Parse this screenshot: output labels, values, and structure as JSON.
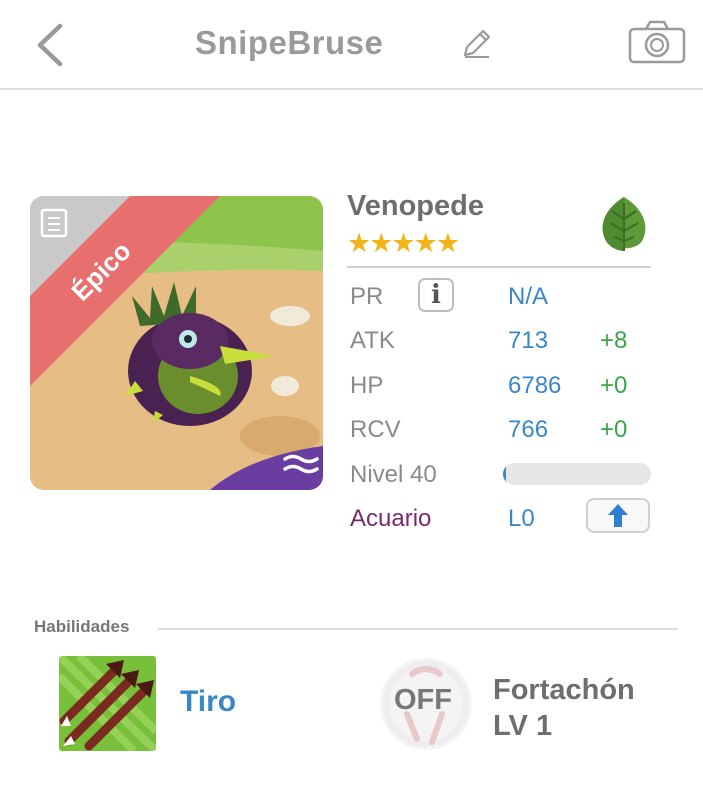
{
  "header": {
    "title": "SnipeBruse",
    "back_icon": "chevron-left-icon",
    "edit_icon": "pencil-icon",
    "camera_icon": "camera-icon"
  },
  "monster": {
    "rarity": "Épico",
    "name": "Venopede",
    "stars": "★★★★★",
    "star_count": 5,
    "element_icon": "leaf-icon",
    "accent_color": "#3a87c8"
  },
  "stats": {
    "pr": {
      "label": "PR",
      "value": "N/A"
    },
    "atk": {
      "label": "ATK",
      "value": "713",
      "bonus": "+8"
    },
    "hp": {
      "label": "HP",
      "value": "6786",
      "bonus": "+0"
    },
    "rcv": {
      "label": "RCV",
      "value": "766",
      "bonus": "+0"
    },
    "level": {
      "label": "Nivel 40",
      "progress": 0.02
    },
    "acuario": {
      "label": "Acuario",
      "value": "L0"
    }
  },
  "skills": {
    "section_title": "Habilidades",
    "skill1": {
      "name": "Tiro"
    },
    "skill2": {
      "status": "OFF",
      "name": "Fortachón",
      "level": "LV 1"
    }
  }
}
